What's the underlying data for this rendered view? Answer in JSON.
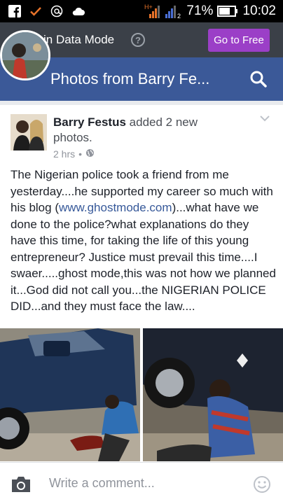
{
  "status_bar": {
    "network": "H+",
    "signal_2": "2",
    "battery_percent": "71%",
    "time": "10:02"
  },
  "data_mode": {
    "text": "in Data Mode",
    "help_glyph": "?",
    "button_label": "Go to Free"
  },
  "header": {
    "title": "Photos from Barry Fe..."
  },
  "post": {
    "author_name": "Barry Festus",
    "action_text": " added 2 new photos.",
    "time": "2 hrs",
    "separator": "•",
    "body_part1": "The Nigerian police took a friend from me yesterday....he supported my career so much with his blog (",
    "body_link": "www.ghostmode.com",
    "body_part2": ")...what have we done to the police?what explanations do they have this time, for taking the life of this young entrepreneur? Justice must prevail this time....I swaer.....ghost mode,this was not how we planned it...God did not call you...the NIGERIAN POLICE DID...and they must face the law...."
  },
  "comment_bar": {
    "placeholder": "Write a comment..."
  },
  "icons": {
    "status_left": [
      "facebook-icon",
      "check-icon",
      "at-icon",
      "cloud-icon"
    ],
    "status_right": [
      "signal-icon",
      "battery-icon"
    ],
    "header": [
      "search-icon"
    ],
    "post": [
      "globe-icon",
      "chevron-down-icon"
    ],
    "comment": [
      "camera-icon",
      "smiley-icon"
    ]
  },
  "colors": {
    "facebook_blue": "#3b5998",
    "data_mode_bar": "#3b4048",
    "go_to_free": "#9b3fc7",
    "link": "#365899",
    "status_bar": "#000000"
  }
}
